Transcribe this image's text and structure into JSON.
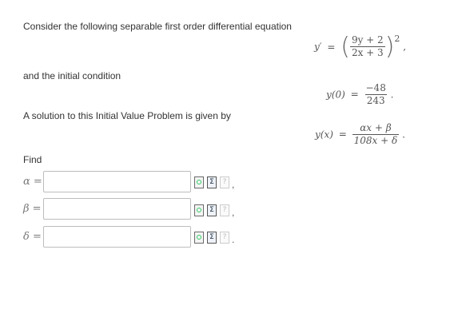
{
  "problem": {
    "intro": "Consider the following separable first order differential equation",
    "initial_condition_text": "and the initial condition",
    "solution_text": "A solution to this Initial Value Problem is given by",
    "find_text": "Find"
  },
  "equation": {
    "lhs": "y′",
    "equals": "=",
    "numerator": "9y + 2",
    "denominator": "2x + 3",
    "exponent": "2",
    "trailing": ","
  },
  "initial_condition": {
    "lhs": "y(0)",
    "equals": "=",
    "numerator": "−48",
    "denominator": "243",
    "trailing": "."
  },
  "solution": {
    "lhs": "y(x)",
    "equals": "=",
    "numerator": "αx + β",
    "denominator": "108x + δ",
    "trailing": "."
  },
  "answers": [
    {
      "symbol": "α",
      "equals": "=",
      "value": "",
      "trailing": ","
    },
    {
      "symbol": "β",
      "equals": "=",
      "value": "",
      "trailing": ","
    },
    {
      "symbol": "δ",
      "equals": "=",
      "value": "",
      "trailing": "."
    }
  ],
  "tool_icons": [
    "preview-icon",
    "equation-editor-icon",
    "help-icon"
  ]
}
